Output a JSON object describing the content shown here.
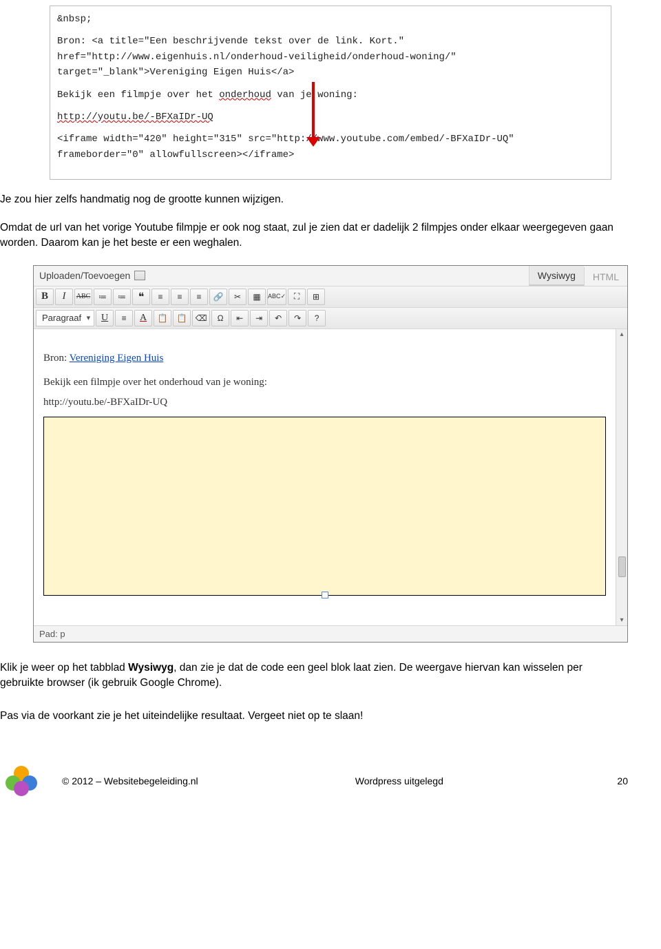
{
  "codebox": {
    "nbsp": "&nbsp;",
    "bron_line": "Bron: <a title=\"Een beschrijvende tekst over de link. Kort.\" href=\"http://www.eigenhuis.nl/onderhoud-veiligheid/onderhoud-woning/\" target=\"_blank\">Vereniging Eigen Huis</a>",
    "watch_prefix": "Bekijk een filmpje over het ",
    "watch_spellerr": "onderhoud",
    "watch_suffix": " van je woning:",
    "url_line": "http://youtu.be/-BFXaIDr-UQ",
    "iframe_line": "<iframe width=\"420\" height=\"315\" src=\"http://www.youtube.com/embed/-BFXaIDr-UQ\" frameborder=\"0\" allowfullscreen></iframe>"
  },
  "para1": "Je zou hier zelfs handmatig nog de grootte kunnen wijzigen.",
  "para2": "Omdat de url van het vorige Youtube filmpje er ook nog staat, zul je zien dat er dadelijk 2 filmpjes onder elkaar weergegeven gaan worden. Daarom kan je het beste er een weghalen.",
  "editor": {
    "upload_label": "Uploaden/Toevoegen",
    "tab_wysiwyg": "Wysiwyg",
    "tab_html": "HTML",
    "row1": {
      "b": "B",
      "i": "I",
      "abc": "ABC",
      "ul": "≔",
      "ol": "≔",
      "quote": "❝",
      "al1": "≡",
      "al2": "≡",
      "al3": "≡",
      "link": "🔗",
      "unlink": "✂",
      "img": "▦",
      "spell": "ABC✓",
      "fs": "⛶",
      "kitchen": "⊞"
    },
    "row2": {
      "format_label": "Paragraaf",
      "u": "U",
      "just": "≡",
      "a": "A",
      "clip1": "📋",
      "clip2": "📋",
      "eraser": "⌫",
      "omega": "Ω",
      "out": "⇤",
      "ind": "⇥",
      "undo": "↶",
      "redo": "↷",
      "help": "?"
    },
    "content": {
      "bron_prefix": "Bron: ",
      "bron_link": "Vereniging Eigen Huis",
      "line2": "Bekijk een filmpje over het onderhoud van je woning:",
      "line3": "http://youtu.be/-BFXaIDr-UQ"
    },
    "status_label": "Pad: p",
    "scroll_up": "▴",
    "scroll_down": "▾"
  },
  "para3_a": "Klik je weer op het tabblad ",
  "para3_b": "Wysiwyg",
  "para3_c": ", dan zie je dat de code een geel blok laat zien. De weergave hiervan kan wisselen per gebruikte browser (ik gebruik Google Chrome).",
  "para4": "Pas via de voorkant zie je het uiteindelijke resultaat. Vergeet niet op te slaan!",
  "footer": {
    "copy": "© 2012 – Websitebegeleiding.nl",
    "title": "Wordpress uitgelegd",
    "page": "20"
  }
}
